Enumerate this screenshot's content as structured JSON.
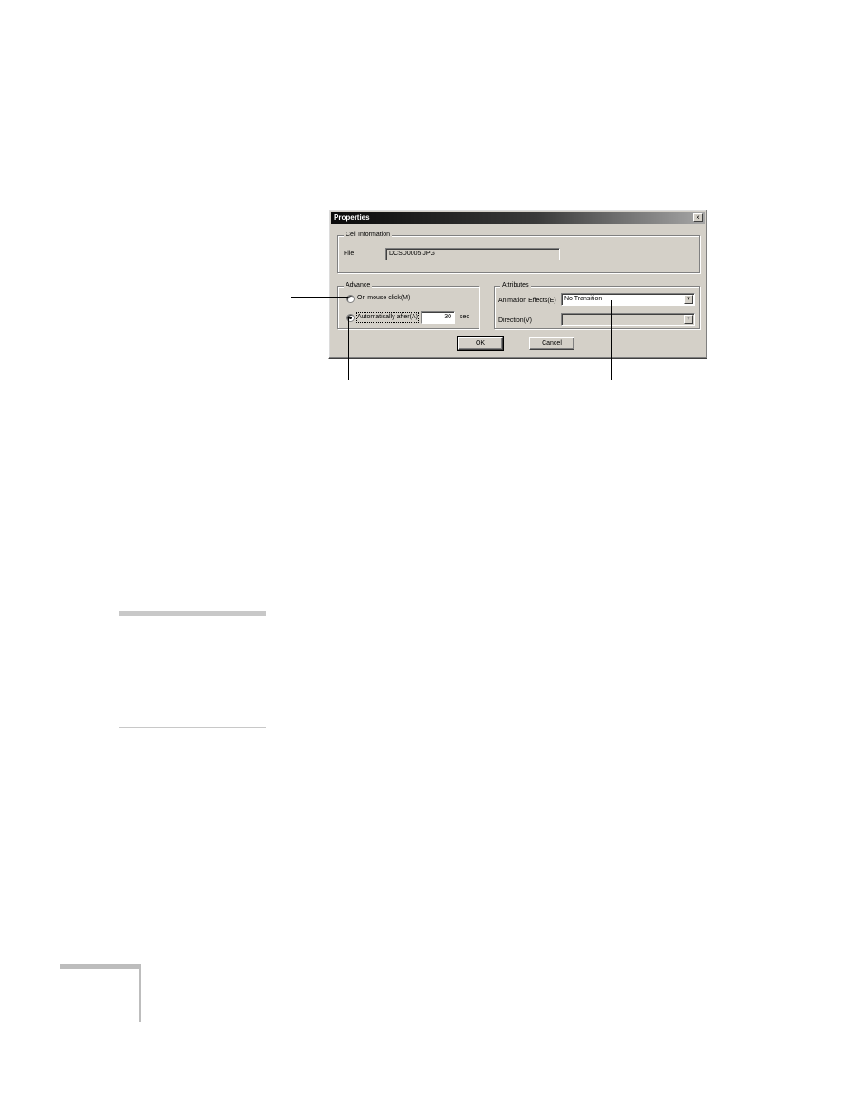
{
  "dialog": {
    "title": "Properties",
    "close_label": "×",
    "cell_information": {
      "legend": "Cell Information",
      "file_label": "File",
      "file_value": "DCSD0005.JPG"
    },
    "advance": {
      "legend": "Advance",
      "on_mouse_click": "On mouse click(M)",
      "on_mouse_click_selected": false,
      "automatically_after": "Automatically after(A)",
      "automatically_after_selected": true,
      "seconds_value": "30",
      "seconds_unit": "sec"
    },
    "attributes": {
      "legend": "Attributes",
      "animation_effects_label": "Animation Effects(E)",
      "animation_effects_value": "No Transition",
      "direction_label": "Direction(V)",
      "direction_value": ""
    },
    "ok_label": "OK",
    "cancel_label": "Cancel",
    "dropdown_arrow": "▼"
  }
}
